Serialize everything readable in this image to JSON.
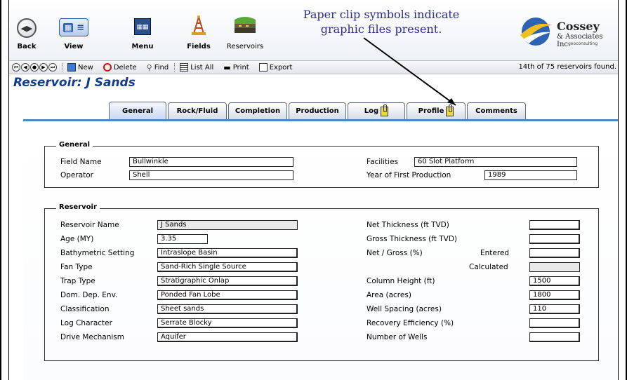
{
  "toolbar": {
    "back_label": "Back",
    "view_label": "View",
    "menu_label": "Menu",
    "fields_label": "Fields",
    "reservoirs_label": "Reservoirs"
  },
  "annotation": {
    "line1": "Paper clip symbols indicate",
    "line2": "graphic files present."
  },
  "logo": {
    "name": "Cossey",
    "sub": "& Associates Inc.",
    "tagline": "geoconsulting"
  },
  "navbar": {
    "new_label": "New",
    "delete_label": "Delete",
    "find_label": "Find",
    "list_all_label": "List All",
    "print_label": "Print",
    "export_label": "Export",
    "record_count": "14th of 75 reservoirs found."
  },
  "page_title": "Reservoir: J Sands",
  "tabs": [
    {
      "label": "General"
    },
    {
      "label": "Rock/Fluid"
    },
    {
      "label": "Completion"
    },
    {
      "label": "Production"
    },
    {
      "label": "Log"
    },
    {
      "label": "Profile"
    },
    {
      "label": "Comments"
    }
  ],
  "general": {
    "title": "General",
    "field_name_label": "Field Name",
    "field_name_value": "Bullwinkle",
    "operator_label": "Operator",
    "operator_value": "Shell",
    "facilities_label": "Facilities",
    "facilities_value": "60 Slot Platform",
    "year_label": "Year of First Production",
    "year_value": "1989"
  },
  "reservoir": {
    "title": "Reservoir",
    "left": [
      {
        "label": "Reservoir Name",
        "value": "J Sands"
      },
      {
        "label": "Age (MY)",
        "value": "3.35"
      },
      {
        "label": "Bathymetric Setting",
        "value": "Intraslope Basin"
      },
      {
        "label": "Fan Type",
        "value": "Sand-Rich Single Source"
      },
      {
        "label": "Trap Type",
        "value": "Stratigraphic Onlap"
      },
      {
        "label": "Dom. Dep. Env.",
        "value": "Ponded Fan Lobe"
      },
      {
        "label": "Classification",
        "value": "Sheet sands"
      },
      {
        "label": "Log Character",
        "value": "Serrate Blocky"
      },
      {
        "label": "Drive Mechanism",
        "value": "Aquifer"
      }
    ],
    "right": [
      {
        "label": "Net Thickness (ft TVD)",
        "value": ""
      },
      {
        "label": "Gross Thickness (ft TVD)",
        "value": ""
      },
      {
        "label": "Net / Gross (%)",
        "value": ""
      },
      {
        "label": "Calculated",
        "value": ""
      },
      {
        "label": "Column Height (ft)",
        "value": "1500"
      },
      {
        "label": "Area (acres)",
        "value": "1800"
      },
      {
        "label": "Well Spacing (acres)",
        "value": "110"
      },
      {
        "label": "Recovery Efficiency (%)",
        "value": ""
      },
      {
        "label": "Number of Wells",
        "value": ""
      }
    ],
    "entered_label": "Entered"
  }
}
